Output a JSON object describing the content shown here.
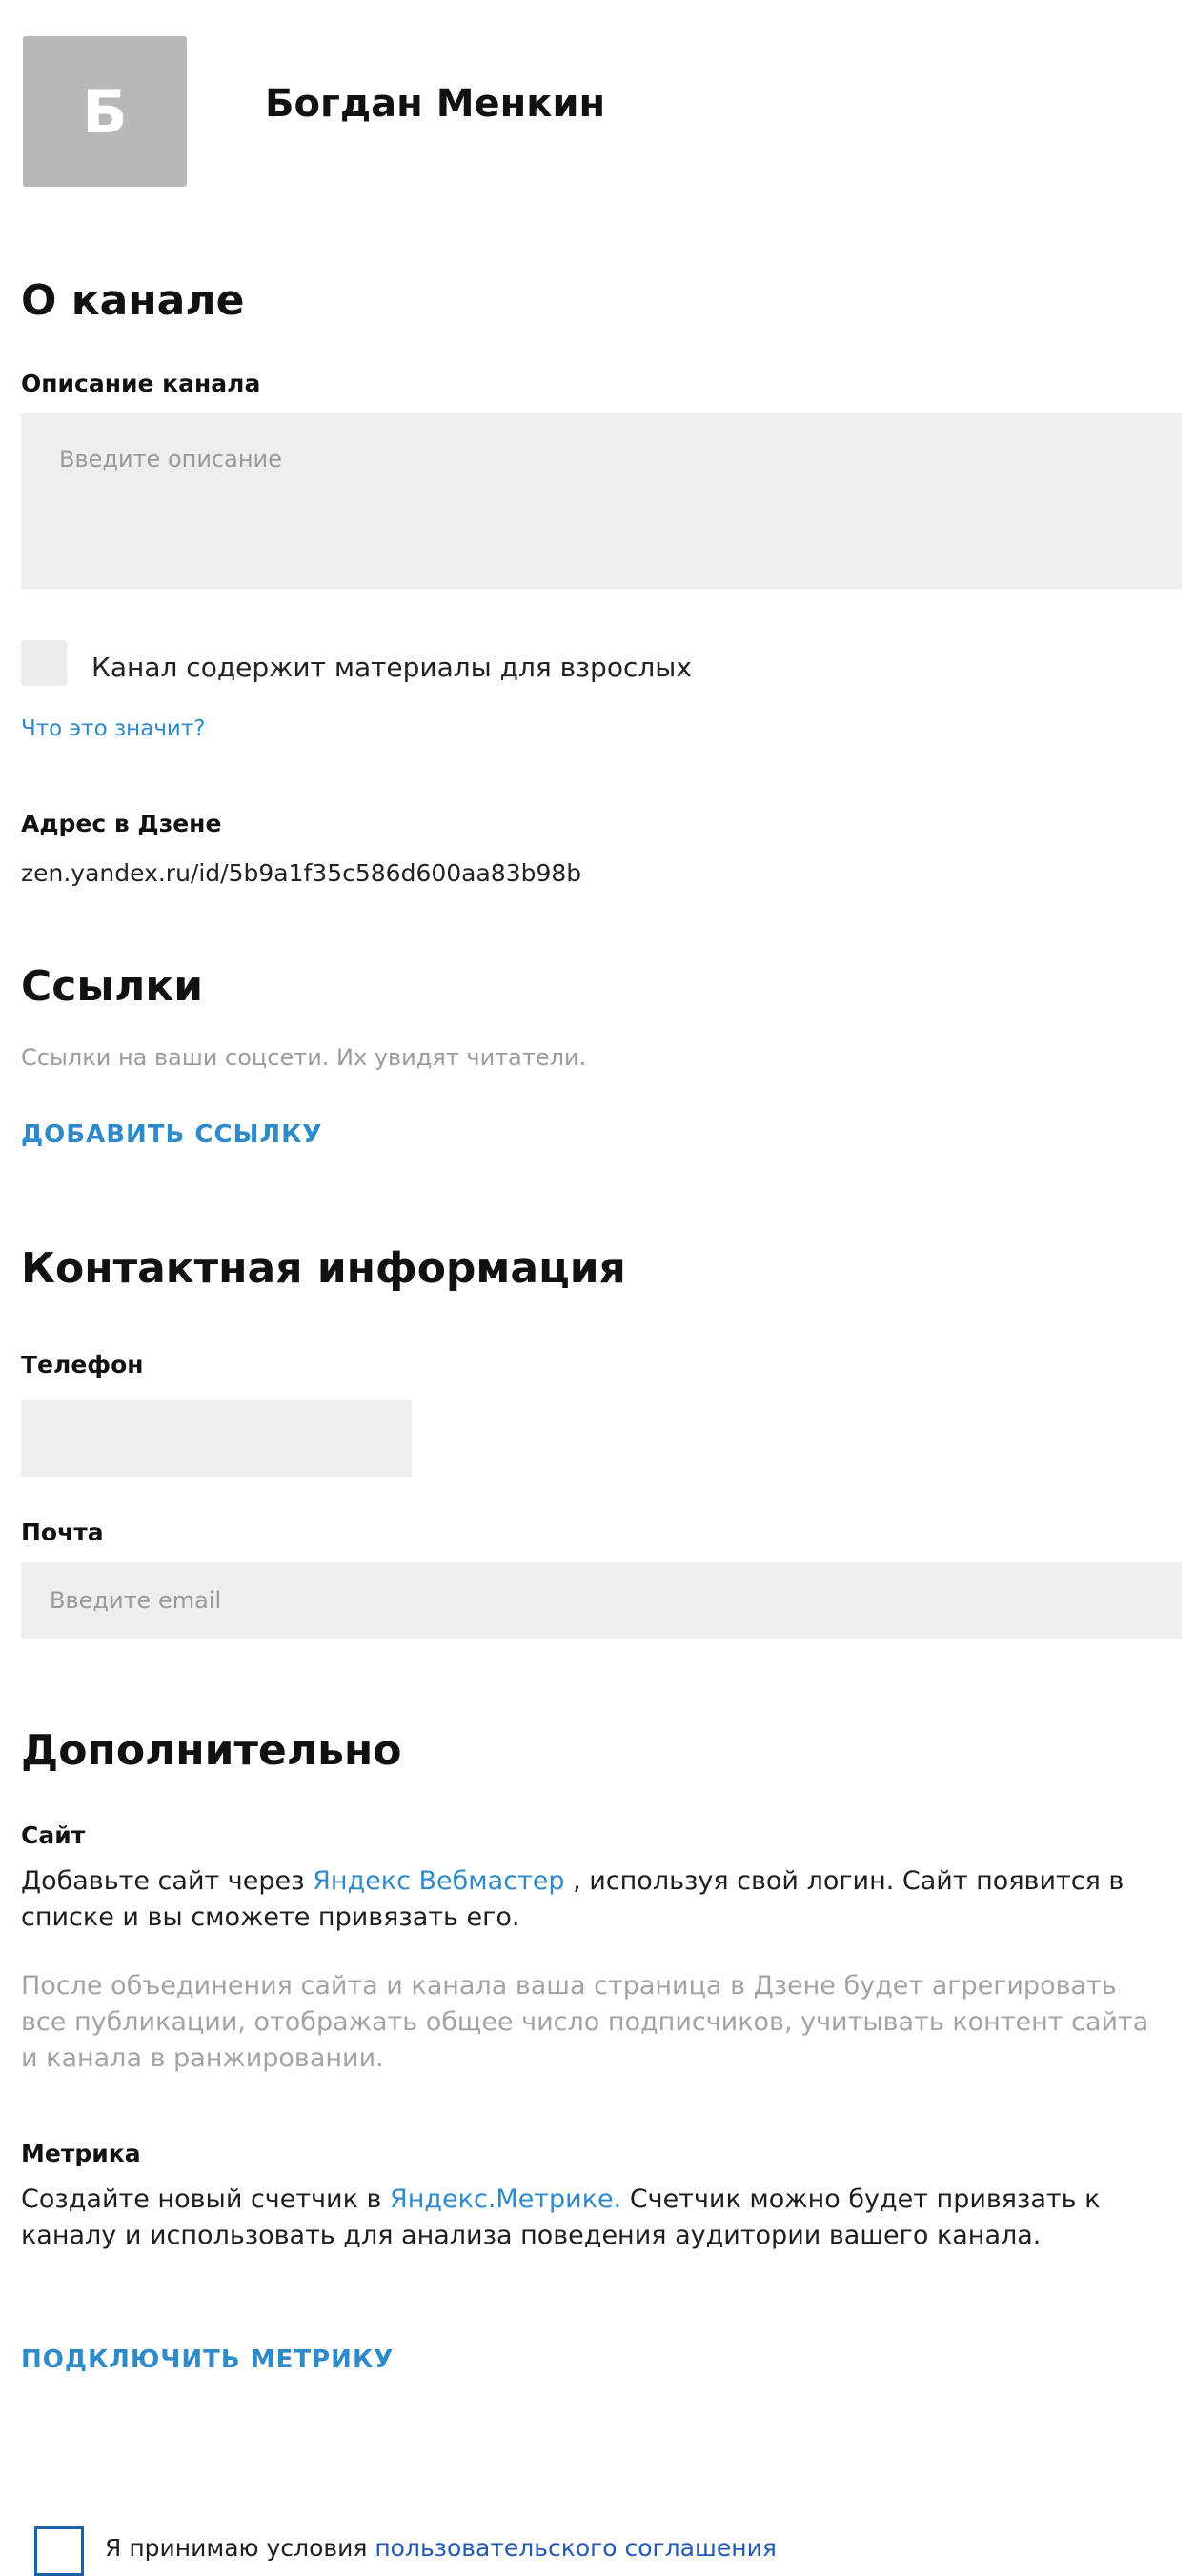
{
  "profile": {
    "avatar_letter": "Б",
    "name": "Богдан Менкин"
  },
  "about": {
    "title": "О канале",
    "description_label": "Описание канала",
    "description_placeholder": "Введите описание",
    "adult_checkbox_label": "Канал содержит материалы для взрослых",
    "what_means_link": "Что это значит?",
    "address_label": "Адрес в Дзене",
    "address_value": "zen.yandex.ru/id/5b9a1f35c586d600aa83b98b"
  },
  "links": {
    "title": "Ссылки",
    "hint": "Ссылки на ваши соцсети. Их увидят читатели.",
    "add_link": "ДОБАВИТЬ ССЫЛКУ"
  },
  "contacts": {
    "title": "Контактная информация",
    "phone_label": "Телефон",
    "phone_value": "",
    "email_label": "Почта",
    "email_placeholder": "Введите email"
  },
  "extra": {
    "title": "Дополнительно",
    "site_label": "Сайт",
    "site_text_before": "Добавьте сайт через ",
    "site_link": "Яндекс Вебмастер",
    "site_text_after": " , используя свой логин. Сайт появится в списке и вы сможете привязать его.",
    "site_note": "После объединения сайта и канала ваша страница в Дзене будет агрегировать все публикации, отображать общее число подписчиков, учитывать контент сайта и канала в ранжировании.",
    "metrika_label": "Метрика",
    "metrika_text_before": "Создайте новый счетчик в ",
    "metrika_link": "Яндекс.Метрике.",
    "metrika_text_after": " Счетчик можно будет привязать к каналу и использовать для анализа поведения аудитории вашего канала.",
    "connect_metrika": "ПОДКЛЮЧИТЬ МЕТРИКУ"
  },
  "agreement": {
    "text_before": "Я принимаю условия ",
    "link": "пользовательского соглашения"
  }
}
